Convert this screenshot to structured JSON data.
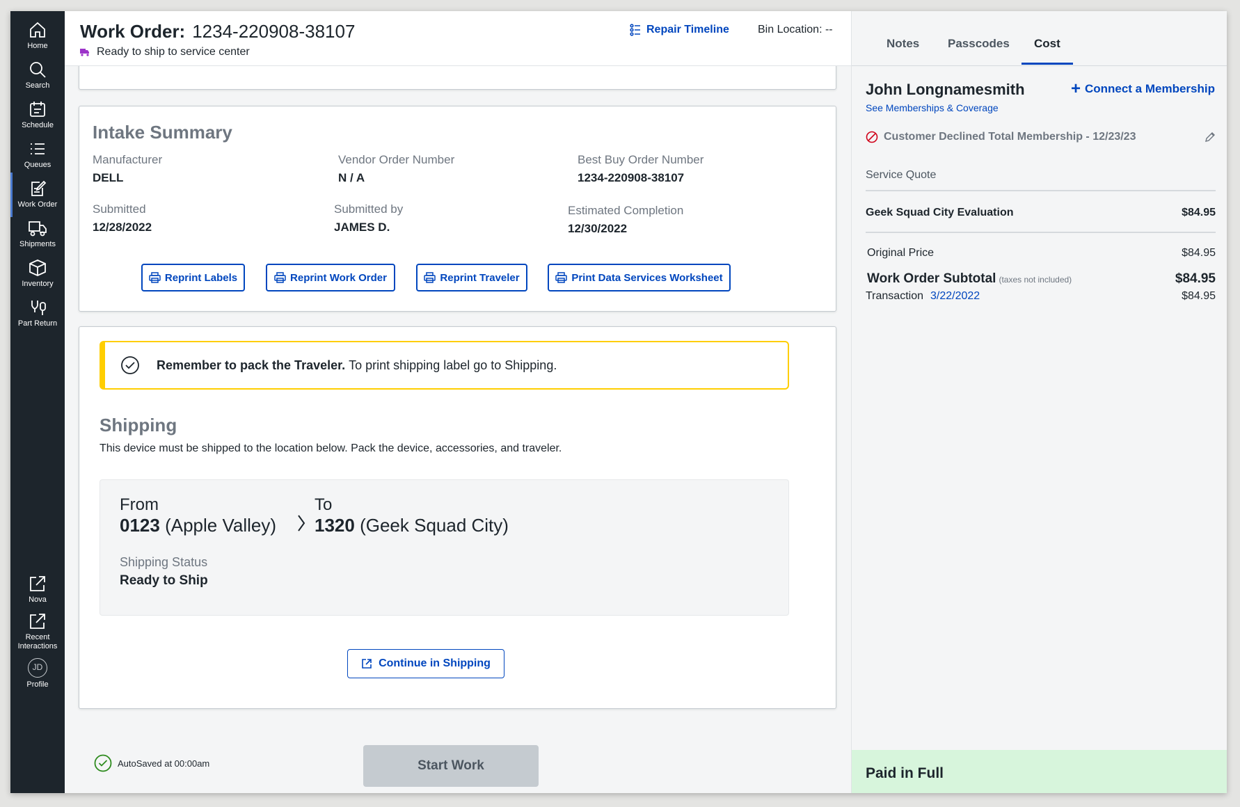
{
  "sidebar": {
    "items": [
      {
        "label": "Home",
        "icon": "home-icon"
      },
      {
        "label": "Search",
        "icon": "search-icon"
      },
      {
        "label": "Schedule",
        "icon": "calendar-icon"
      },
      {
        "label": "Queues",
        "icon": "list-icon"
      },
      {
        "label": "Work Order",
        "icon": "clipboard-icon"
      },
      {
        "label": "Shipments",
        "icon": "truck-icon"
      },
      {
        "label": "Inventory",
        "icon": "box-icon"
      },
      {
        "label": "Part Return",
        "icon": "plug-icon"
      }
    ],
    "bottom": [
      {
        "label": "Nova",
        "icon": "external-link-icon"
      },
      {
        "label": "Recent Interactions",
        "icon": "external-link-icon"
      }
    ],
    "profile": {
      "initials": "JD",
      "label": "Profile"
    },
    "active": "Work Order"
  },
  "header": {
    "title_prefix": "Work Order:",
    "order_number": "1234-220908-38107",
    "status": "Ready to ship to service center",
    "repair_timeline": "Repair Timeline",
    "bin_location": "Bin Location: --"
  },
  "intake": {
    "title": "Intake Summary",
    "manufacturer_label": "Manufacturer",
    "manufacturer": "DELL",
    "vendor_order_label": "Vendor Order Number",
    "vendor_order": "N / A",
    "bby_order_label": "Best Buy Order Number",
    "bby_order": "1234-220908-38107",
    "submitted_label": "Submitted",
    "submitted": "12/28/2022",
    "submitted_by_label": "Submitted by",
    "submitted_by": "JAMES D.",
    "est_completion_label": "Estimated Completion",
    "est_completion": "12/30/2022",
    "buttons": [
      "Reprint Labels",
      "Reprint Work Order",
      "Reprint Traveler",
      "Print Data Services Worksheet"
    ]
  },
  "shipping": {
    "alert_bold": "Remember to pack the Traveler.",
    "alert_text": "To print shipping label go to Shipping.",
    "title": "Shipping",
    "description": "This device must be shipped to the location below. Pack the device, accessories, and traveler.",
    "from_label": "From",
    "from_code": "0123",
    "from_name": "(Apple Valley)",
    "to_label": "To",
    "to_code": "1320",
    "to_name": "(Geek Squad City)",
    "status_label": "Shipping Status",
    "status": "Ready to Ship",
    "continue": "Continue in Shipping"
  },
  "footer": {
    "autosave": "AutoSaved at 00:00am",
    "start_work": "Start Work"
  },
  "panel": {
    "tabs": [
      "Notes",
      "Passcodes",
      "Cost"
    ],
    "active_tab": "Cost",
    "customer": "John Longnamesmith",
    "see_memberships": "See Memberships & Coverage",
    "connect": "Connect a Membership",
    "declined": "Customer Declined Total Membership - 12/23/23",
    "service_quote": "Service Quote",
    "line_item": "Geek Squad City Evaluation",
    "line_price": "$84.95",
    "original_label": "Original Price",
    "original_price": "$84.95",
    "subtotal_label": "Work Order Subtotal",
    "subtotal_note": "(taxes not included)",
    "subtotal": "$84.95",
    "transaction_label": "Transaction",
    "transaction_date": "3/22/2022",
    "transaction_amount": "$84.95",
    "paid": "Paid in Full"
  },
  "colors": {
    "accent": "#0046be",
    "sidebar": "#1d252c",
    "alert": "#ffce00",
    "paid": "#d7f5dc"
  }
}
